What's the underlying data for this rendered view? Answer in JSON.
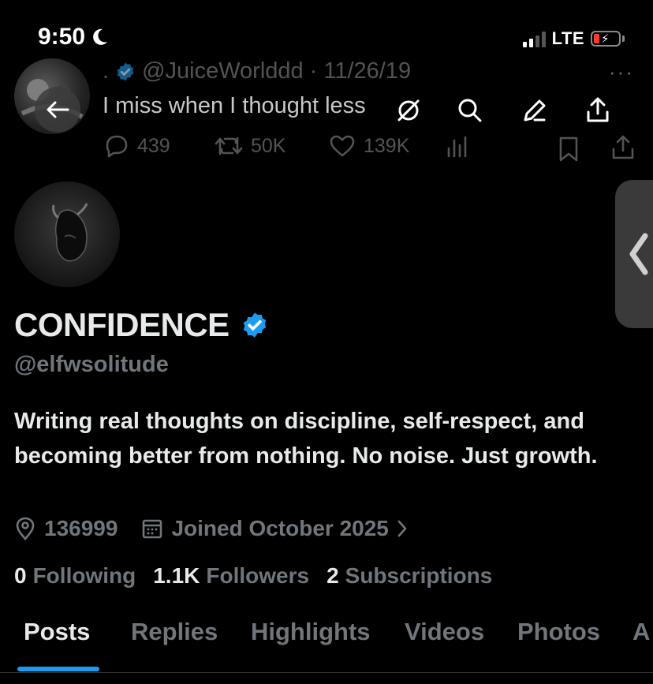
{
  "status_bar": {
    "time": "9:50",
    "network": "LTE",
    "moon_icon": "moon-icon",
    "battery_icon": "battery-charging-icon"
  },
  "tweet": {
    "dot": ".",
    "handle": "@JuiceWorlddd",
    "separator": "·",
    "date": "11/26/19",
    "text": "I miss when I thought less",
    "replies": "439",
    "retweets": "50K",
    "likes": "139K",
    "more": "···"
  },
  "top_actions": [
    "grok-icon",
    "search-icon",
    "edit-icon",
    "share-icon"
  ],
  "profile": {
    "name": "CONFIDENCE",
    "handle": "@elfwsolitude",
    "bio": "Writing real thoughts on discipline, self-respect, and becoming better from nothing. No noise. Just growth.",
    "location": "136999",
    "joined": "Joined October 2025",
    "following_count": "0",
    "following_label": "Following",
    "followers_count": "1.1K",
    "followers_label": "Followers",
    "subscriptions_count": "2",
    "subscriptions_label": "Subscriptions"
  },
  "tabs": [
    {
      "label": "Posts",
      "active": true
    },
    {
      "label": "Replies"
    },
    {
      "label": "Highlights"
    },
    {
      "label": "Videos"
    },
    {
      "label": "Photos"
    },
    {
      "label": "A"
    }
  ],
  "colors": {
    "accent": "#1d9bf0",
    "background": "#000000",
    "muted": "#71767b",
    "battery_low": "#ff3b30"
  }
}
